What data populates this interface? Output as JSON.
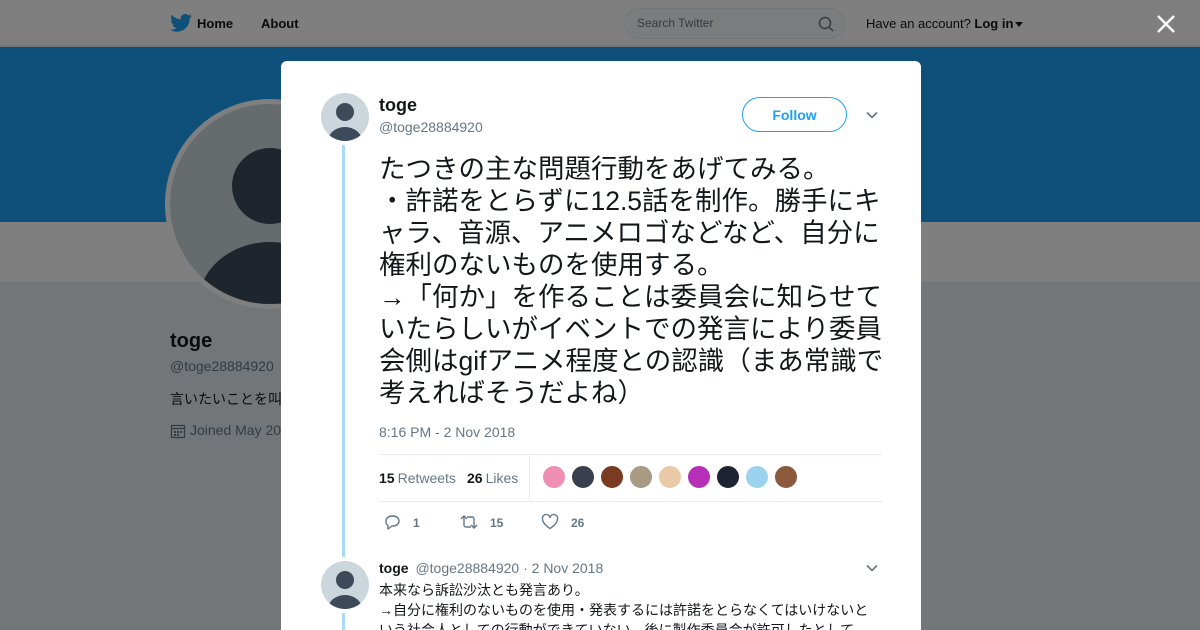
{
  "nav": {
    "home_label": "Home",
    "about_label": "About",
    "search_placeholder": "Search Twitter",
    "account_prompt": "Have an account?",
    "login_label": "Log in"
  },
  "profile": {
    "name": "toge",
    "handle": "@toge28884920",
    "bio": "言いたいことを叫",
    "joined": "Joined May 20"
  },
  "tweet": {
    "author_name": "toge",
    "author_handle": "@toge28884920",
    "follow_label": "Follow",
    "text": "たつきの主な問題行動をあげてみる。\n・許諾をとらずに12.5話を制作。勝手にキャラ、音源、アニメロゴなどなど、自分に権利のないものを使用する。\n→「何か」を作ることは委員会に知らせていたらしいがイベントでの発言により委員会側はgifアニメ程度との認識（まあ常識で考えればそうだよね）",
    "timestamp": "8:16 PM - 2 Nov 2018",
    "retweets_count": "15",
    "retweets_label": "Retweets",
    "likes_count": "26",
    "likes_label": "Likes",
    "reply_count": "1",
    "retweet_action_count": "15",
    "like_action_count": "26"
  },
  "likers": [
    {
      "name": "liker-avatar-1",
      "color": "#f08fb4"
    },
    {
      "name": "liker-avatar-2",
      "color": "#3a3f4d"
    },
    {
      "name": "liker-avatar-3",
      "color": "#7a3b22"
    },
    {
      "name": "liker-avatar-4",
      "color": "#a89a83"
    },
    {
      "name": "liker-avatar-5",
      "color": "#e9c9a8"
    },
    {
      "name": "liker-avatar-6",
      "color": "#b52fb8"
    },
    {
      "name": "liker-avatar-7",
      "color": "#1d2330"
    },
    {
      "name": "liker-avatar-8",
      "color": "#9bd3ee"
    },
    {
      "name": "liker-avatar-9",
      "color": "#8b5a3c"
    }
  ],
  "reply": {
    "author_name": "toge",
    "author_handle": "@toge28884920",
    "date": "· 2 Nov 2018",
    "text": "本来なら訴訟沙汰とも発言あり。\n→自分に権利のないものを使用・発表するには許諾をとらなくてはいけないという社会人としての行動ができていない。後に製作委員会が許可したとして"
  },
  "colors": {
    "brand_blue": "#1da1f2",
    "thread_line": "#a8dbf8",
    "overlay": "rgba(0,0,0,0.5)"
  },
  "icons": {
    "brand": "twitter-bird-icon",
    "search": "search-icon",
    "close": "close-icon",
    "reply": "reply-icon",
    "retweet": "retweet-icon",
    "like": "heart-icon",
    "calendar": "calendar-icon",
    "chevron": "chevron-down-icon"
  }
}
